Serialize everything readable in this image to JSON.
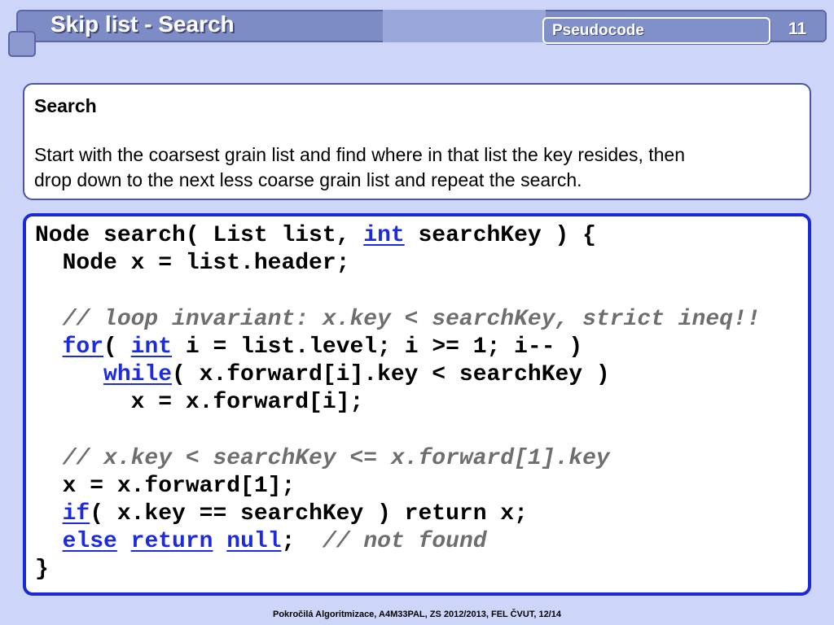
{
  "header": {
    "title": "Skip list - Search",
    "section": "Pseudocode",
    "page_number": "11"
  },
  "description": {
    "heading": "Search",
    "lines": [
      "Start with the coarsest grain list and find where in that list the key resides, then",
      "drop down to the next less coarse grain list and repeat the search."
    ]
  },
  "code": {
    "lines": [
      [
        {
          "t": "Node search( List list, ",
          "c": "plain"
        },
        {
          "t": "int",
          "c": "kw"
        },
        {
          "t": " searchKey ) {",
          "c": "plain"
        }
      ],
      [
        {
          "t": "  Node x = list.header;",
          "c": "plain"
        }
      ],
      [],
      [
        {
          "t": "  ",
          "c": "plain"
        },
        {
          "t": "// loop invariant: x.key < searchKey, strict ineq!!",
          "c": "cmt"
        }
      ],
      [
        {
          "t": "  ",
          "c": "plain"
        },
        {
          "t": "for",
          "c": "kw"
        },
        {
          "t": "( ",
          "c": "plain"
        },
        {
          "t": "int",
          "c": "kw"
        },
        {
          "t": " i = list.level; i >= 1; i-- )",
          "c": "plain"
        }
      ],
      [
        {
          "t": "     ",
          "c": "plain"
        },
        {
          "t": "while",
          "c": "kw"
        },
        {
          "t": "( x.forward[i].key < searchKey )",
          "c": "plain"
        }
      ],
      [
        {
          "t": "       x = x.forward[i];",
          "c": "plain"
        }
      ],
      [],
      [
        {
          "t": "  ",
          "c": "plain"
        },
        {
          "t": "// x.key < searchKey <= x.forward[1].key",
          "c": "cmt"
        }
      ],
      [
        {
          "t": "  x = x.forward[1];",
          "c": "plain"
        }
      ],
      [
        {
          "t": "  ",
          "c": "plain"
        },
        {
          "t": "if",
          "c": "kw"
        },
        {
          "t": "( x.key == searchKey ) return x;",
          "c": "plain"
        }
      ],
      [
        {
          "t": "  ",
          "c": "plain"
        },
        {
          "t": "else",
          "c": "kw"
        },
        {
          "t": " ",
          "c": "plain"
        },
        {
          "t": "return",
          "c": "kw"
        },
        {
          "t": " ",
          "c": "plain"
        },
        {
          "t": "null",
          "c": "kw"
        },
        {
          "t": ";  ",
          "c": "plain"
        },
        {
          "t": "// not found",
          "c": "cmt"
        }
      ],
      [
        {
          "t": "}",
          "c": "plain"
        }
      ]
    ]
  },
  "footer": {
    "text": "Pokročilá Algoritmizace, A4M33PAL, ZS 2012/2013, FEL ČVUT,  12/14"
  },
  "colors": {
    "background": "#cdd6f8",
    "header_bar": "#7e8cc6",
    "keyword": "#1c2ae0",
    "comment": "#6e6e6e",
    "code_border": "#1a2ad8"
  }
}
